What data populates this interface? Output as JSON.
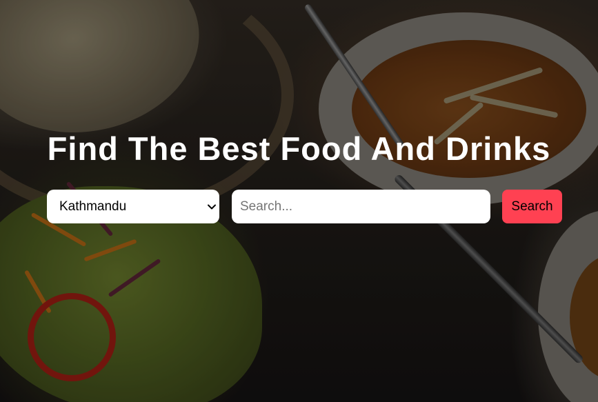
{
  "hero": {
    "heading": "Find The Best Food And Drinks",
    "background": "food-photo"
  },
  "search": {
    "city_selected": "Kathmandu",
    "placeholder": "Search...",
    "value": "",
    "button_label": "Search"
  },
  "colors": {
    "accent": "#ff4152",
    "heading": "#ffffff",
    "field_bg": "#ffffff"
  },
  "icons": {
    "select_arrow": "chevron-down-icon"
  }
}
